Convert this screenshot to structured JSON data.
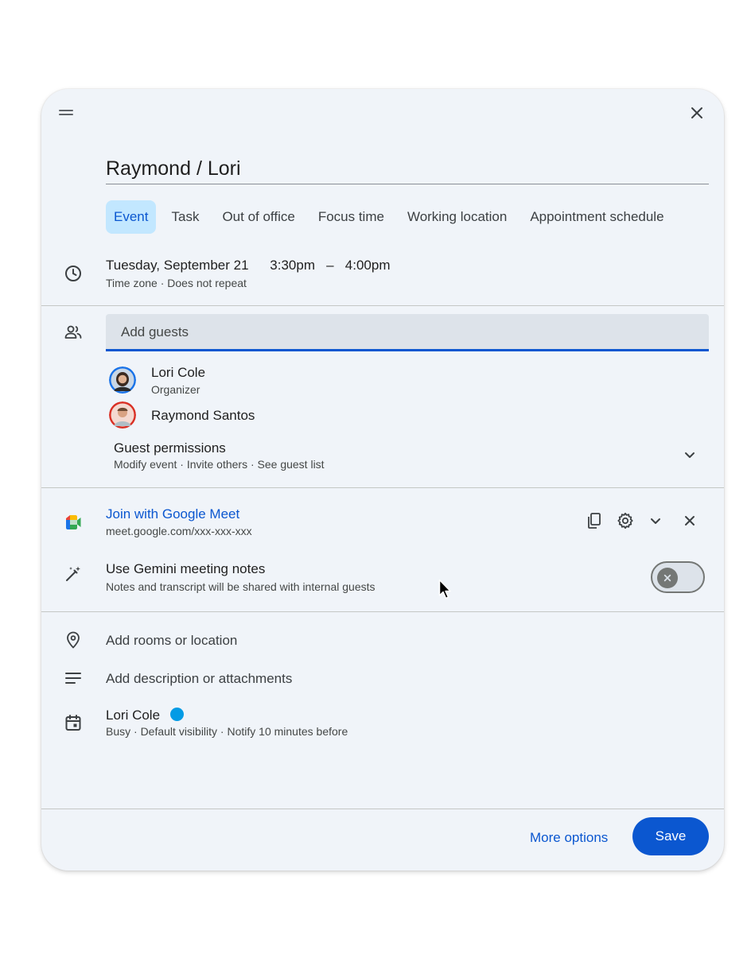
{
  "event": {
    "title": "Raymond / Lori"
  },
  "tabs": [
    {
      "label": "Event",
      "active": true
    },
    {
      "label": "Task"
    },
    {
      "label": "Out of office"
    },
    {
      "label": "Focus time"
    },
    {
      "label": "Working location"
    },
    {
      "label": "Appointment schedule"
    }
  ],
  "datetime": {
    "date": "Tuesday, September 21",
    "start": "3:30pm",
    "separator": "–",
    "end": "4:00pm",
    "details": "Time zone · Does not repeat"
  },
  "guests": {
    "placeholder": "Add guests",
    "list": [
      {
        "name": "Lori Cole",
        "role": "Organizer"
      },
      {
        "name": "Raymond Santos"
      }
    ],
    "permissions_title": "Guest permissions",
    "permissions_details": "Modify event · Invite others · See guest list"
  },
  "meet": {
    "link_label": "Join with Google Meet",
    "url": "meet.google.com/xxx-xxx-xxx"
  },
  "gemini": {
    "title": "Use Gemini meeting notes",
    "details": "Notes and transcript will be shared with internal guests",
    "enabled": false
  },
  "location": {
    "placeholder": "Add rooms or location"
  },
  "description": {
    "placeholder": "Add description or attachments"
  },
  "calendar": {
    "owner": "Lori Cole",
    "color": "#039be5",
    "details": "Busy · Default visibility · Notify 10 minutes before"
  },
  "footer": {
    "more_options_label": "More options",
    "save_label": "Save"
  },
  "colors": {
    "accent": "#0b57d0",
    "active_tab_bg": "#c2e7ff",
    "dialog_bg": "#f0f4f9"
  },
  "icons": {
    "handle": "drag-handle-icon",
    "close": "close-icon",
    "time": "clock-icon",
    "guests": "people-icon",
    "meet": "google-meet-icon",
    "copy": "copy-icon",
    "settings": "gear-icon",
    "expand": "chevron-down-icon",
    "gemini": "pen-sparkle-icon",
    "location": "location-pin-icon",
    "description": "notes-icon",
    "calendar": "calendar-icon"
  }
}
